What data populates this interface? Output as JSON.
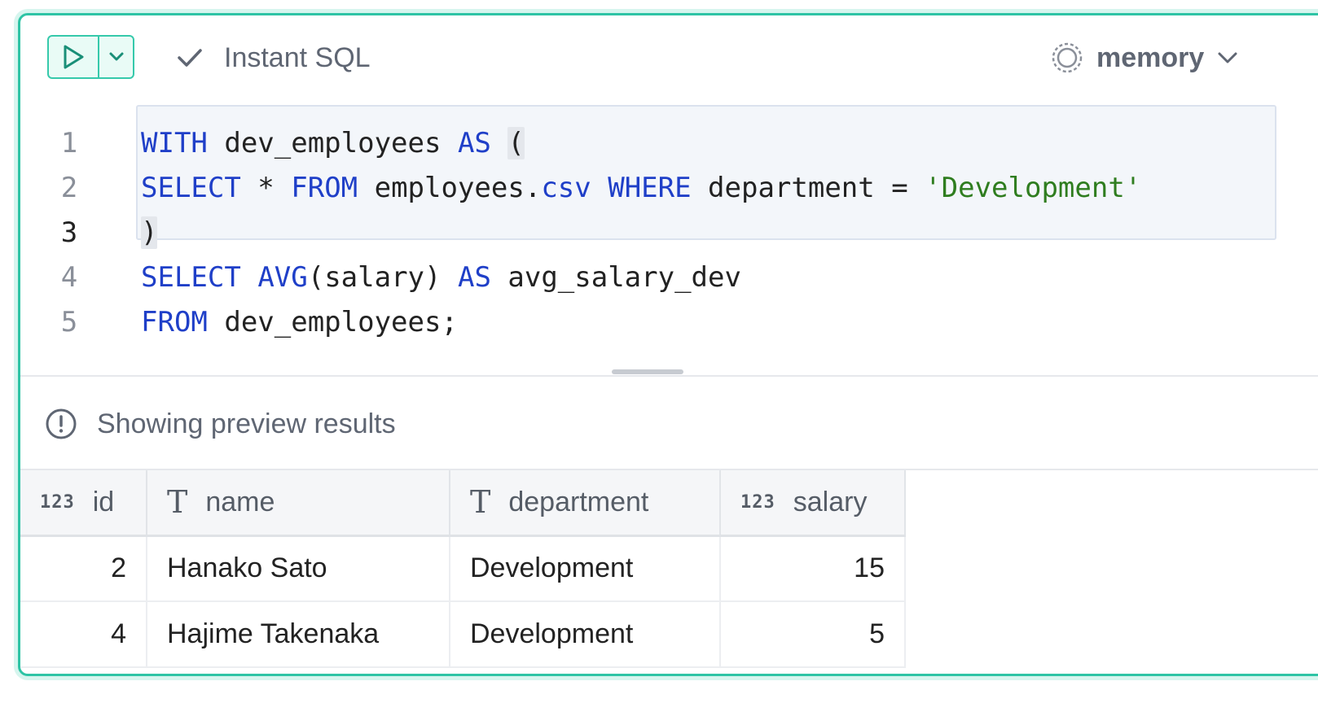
{
  "toolbar": {
    "run_icon": "play-icon",
    "dropdown_icon": "chevron-down-icon",
    "instant_sql_icon": "check-icon",
    "instant_sql_label": "Instant SQL",
    "database_icon": "dashed-circle-icon",
    "database_label": "memory",
    "database_dropdown_icon": "chevron-down-icon"
  },
  "editor": {
    "lines": [
      {
        "number": "1",
        "tokens": [
          {
            "text": "WITH",
            "t": "kw"
          },
          {
            "text": " dev_employees ",
            "t": "id"
          },
          {
            "text": "AS",
            "t": "kw"
          },
          {
            "text": " ",
            "t": "id"
          },
          {
            "text": "(",
            "t": "paren"
          }
        ]
      },
      {
        "number": "2",
        "tokens": [
          {
            "text": "SELECT",
            "t": "kw"
          },
          {
            "text": " * ",
            "t": "id"
          },
          {
            "text": "FROM",
            "t": "kw"
          },
          {
            "text": " employees.",
            "t": "id"
          },
          {
            "text": "csv",
            "t": "kw"
          },
          {
            "text": " ",
            "t": "id"
          },
          {
            "text": "WHERE",
            "t": "kw"
          },
          {
            "text": " department = ",
            "t": "id"
          },
          {
            "text": "'Development'",
            "t": "str"
          }
        ]
      },
      {
        "number": "3",
        "tokens": [
          {
            "text": ")",
            "t": "paren"
          }
        ]
      },
      {
        "number": "4",
        "tokens": [
          {
            "text": "SELECT",
            "t": "kw"
          },
          {
            "text": " ",
            "t": "id"
          },
          {
            "text": "AVG",
            "t": "kw"
          },
          {
            "text": "(salary) ",
            "t": "id"
          },
          {
            "text": "AS",
            "t": "kw"
          },
          {
            "text": " avg_salary_dev",
            "t": "id"
          }
        ]
      },
      {
        "number": "5",
        "tokens": [
          {
            "text": "FROM",
            "t": "kw"
          },
          {
            "text": " dev_employees;",
            "t": "id"
          }
        ]
      }
    ],
    "active_line": "3"
  },
  "results": {
    "notice_icon": "info-circle-icon",
    "notice": "Showing preview results",
    "columns": [
      {
        "type": "123",
        "name": "id"
      },
      {
        "type": "T",
        "name": "name"
      },
      {
        "type": "T",
        "name": "department"
      },
      {
        "type": "123",
        "name": "salary"
      }
    ],
    "rows": [
      [
        "2",
        "Hanako Sato",
        "Development",
        "15"
      ],
      [
        "4",
        "Hajime Takenaka",
        "Development",
        "5"
      ]
    ]
  },
  "colors": {
    "accent": "#2ec4a5",
    "keyword": "#1f3fc8",
    "string": "#2f7d1f"
  }
}
